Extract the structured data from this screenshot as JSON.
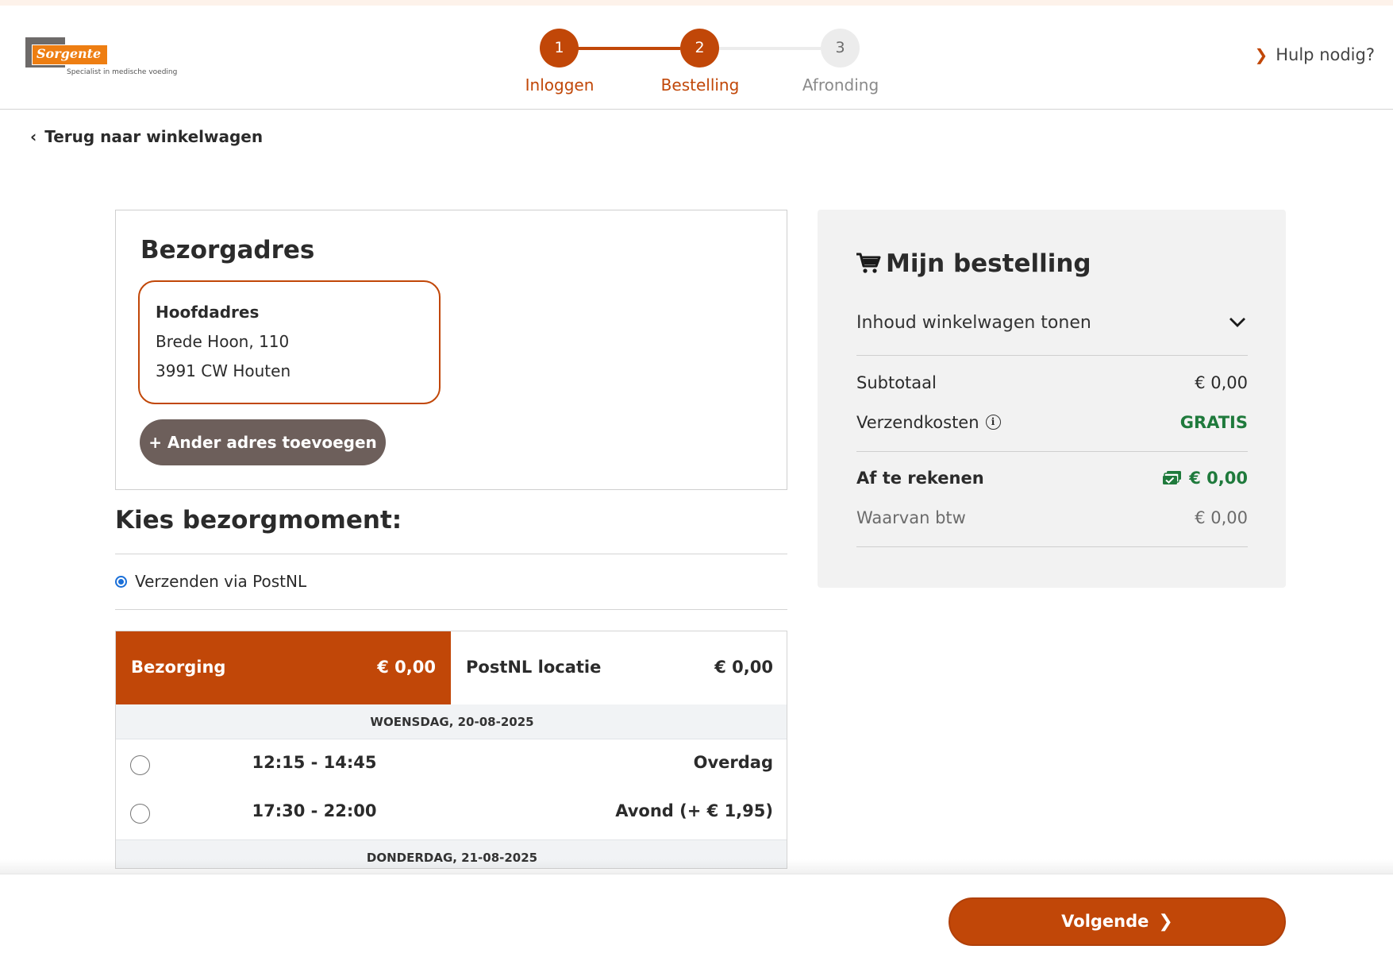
{
  "header": {
    "brand": "Sorgente",
    "tagline": "Specialist in medische voeding",
    "steps": [
      {
        "number": "1",
        "label": "Inloggen"
      },
      {
        "number": "2",
        "label": "Bestelling"
      },
      {
        "number": "3",
        "label": "Afronding"
      }
    ],
    "help": "Hulp nodig?"
  },
  "back_link": "Terug naar winkelwagen",
  "address": {
    "title": "Bezorgadres",
    "name": "Hoofdadres",
    "street": "Brede Hoon, 110",
    "city": "3991 CW Houten",
    "add_button": "+ Ander adres toevoegen"
  },
  "delivery": {
    "title": "Kies bezorgmoment:",
    "method": "Verzenden via PostNL",
    "tabs": [
      {
        "label": "Bezorging",
        "price": "€ 0,00"
      },
      {
        "label": "PostNL locatie",
        "price": "€ 0,00"
      }
    ],
    "days": [
      {
        "date": "WOENSDAG, 20-08-2025",
        "slots": [
          {
            "time": "12:15 - 14:45",
            "kind": "Overdag"
          },
          {
            "time": "17:30 - 22:00",
            "kind": "Avond (+ € 1,95)"
          }
        ]
      },
      {
        "date": "DONDERDAG, 21-08-2025",
        "slots": []
      }
    ]
  },
  "summary": {
    "title": "Mijn bestelling",
    "show_cart": "Inhoud winkelwagen tonen",
    "subtotal_label": "Subtotaal",
    "subtotal_value": "€ 0,00",
    "shipping_label": "Verzendkosten",
    "shipping_value": "GRATIS",
    "total_label": "Af te rekenen",
    "total_value": "€ 0,00",
    "vat_label": "Waarvan btw",
    "vat_value": "€ 0,00"
  },
  "footer": {
    "next_button": "Volgende"
  },
  "colors": {
    "accent": "#c14708",
    "green": "#1f7a3c",
    "brand_orange": "#ee7e12"
  }
}
